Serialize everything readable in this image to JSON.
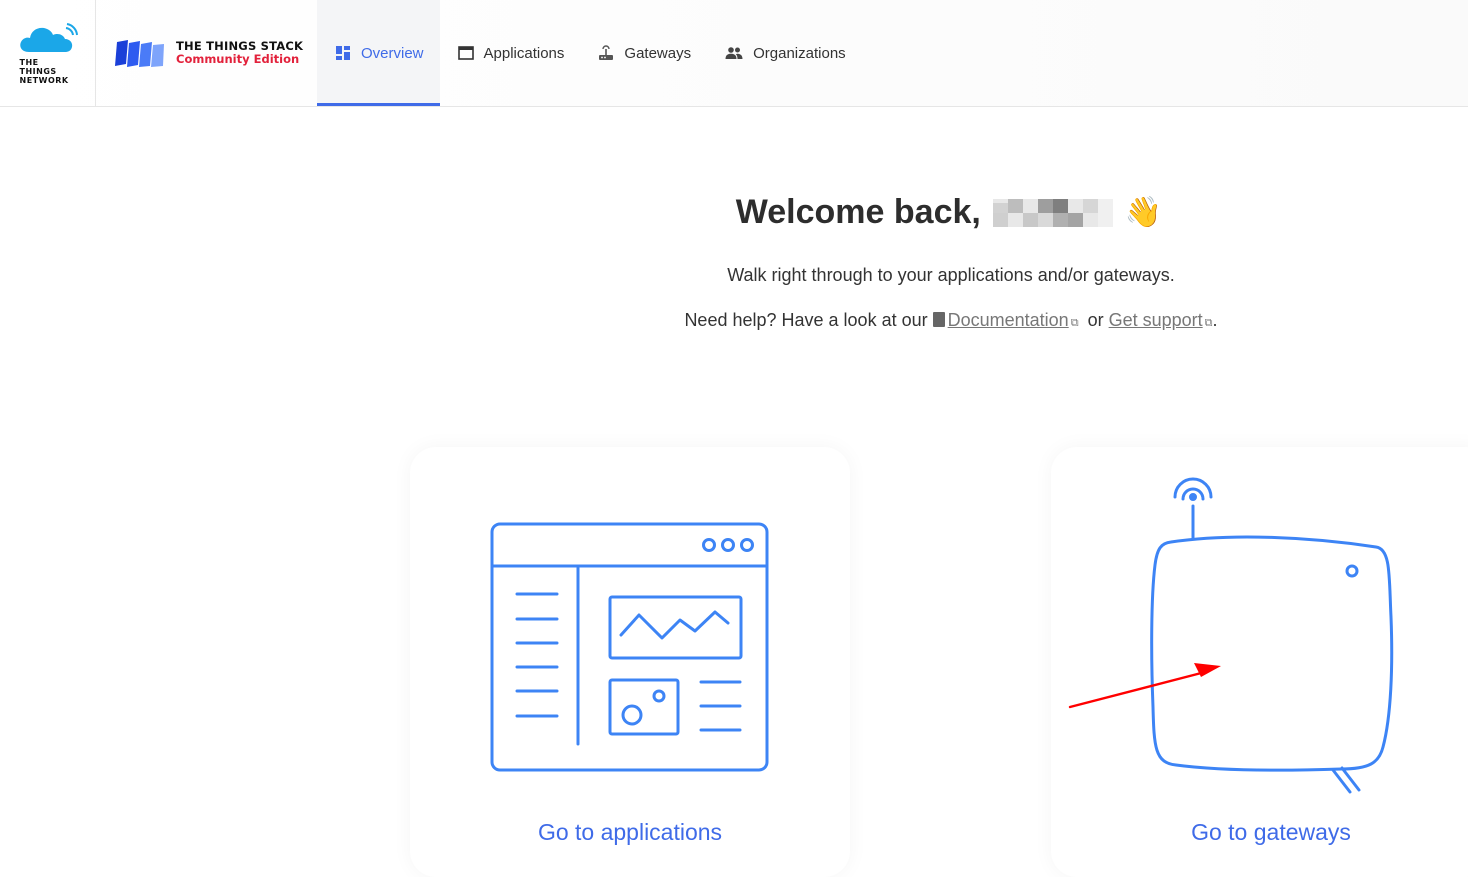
{
  "header": {
    "ttn_logo": {
      "line1": "THE THINGS",
      "line2": "NETWORK"
    },
    "tts_logo": {
      "title": "THE THINGS STACK",
      "edition": "Community Edition"
    },
    "nav": [
      {
        "label": "Overview",
        "icon": "dashboard-icon",
        "active": true
      },
      {
        "label": "Applications",
        "icon": "window-icon",
        "active": false
      },
      {
        "label": "Gateways",
        "icon": "router-icon",
        "active": false
      },
      {
        "label": "Organizations",
        "icon": "people-icon",
        "active": false
      }
    ]
  },
  "main": {
    "welcome_prefix": "Welcome back,",
    "wave_emoji": "👋",
    "subtitle": "Walk right through to your applications and/or gateways.",
    "help": {
      "prefix": "Need help? Have a look at our",
      "doc_link": "Documentation",
      "middle": "or",
      "support_link": "Get support",
      "suffix": "."
    },
    "cards": [
      {
        "label": "Go to applications",
        "illustration": "application-window-illustration"
      },
      {
        "label": "Go to gateways",
        "illustration": "gateway-device-illustration"
      }
    ]
  },
  "colors": {
    "accent": "#3f6be8",
    "illustration": "#3d84f5",
    "brand_red": "#e2213b",
    "annotation_arrow": "#ff0000"
  }
}
